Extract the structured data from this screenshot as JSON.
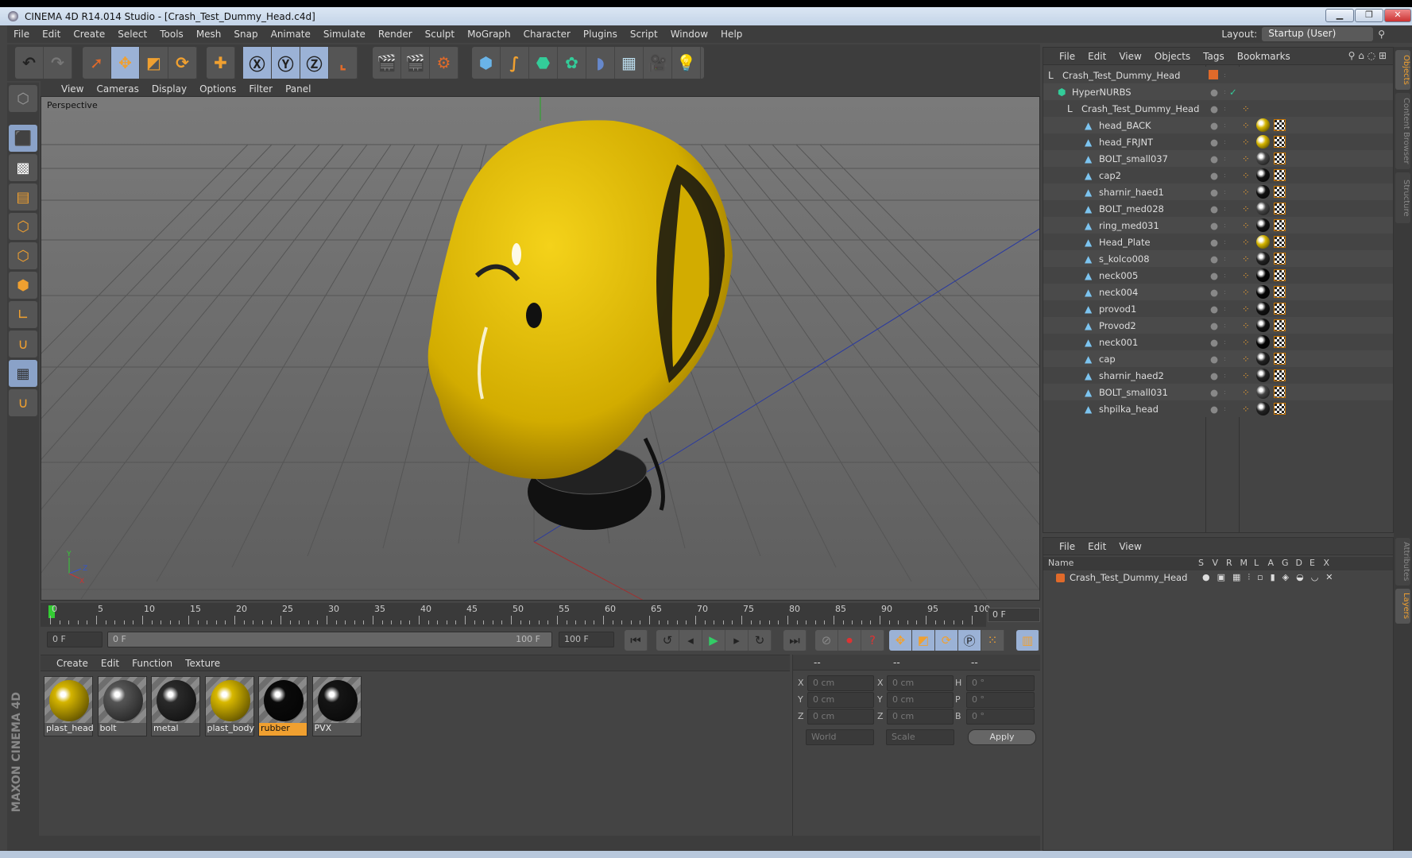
{
  "window": {
    "title": "CINEMA 4D R14.014 Studio - [Crash_Test_Dummy_Head.c4d]"
  },
  "menu": [
    "File",
    "Edit",
    "Create",
    "Select",
    "Tools",
    "Mesh",
    "Snap",
    "Animate",
    "Simulate",
    "Render",
    "Sculpt",
    "MoGraph",
    "Character",
    "Plugins",
    "Script",
    "Window",
    "Help"
  ],
  "layout": {
    "label": "Layout:",
    "value": "Startup (User)"
  },
  "viewport": {
    "menu": [
      "View",
      "Cameras",
      "Display",
      "Options",
      "Filter",
      "Panel"
    ],
    "camera": "Perspective"
  },
  "timeline": {
    "ticks": [
      "0",
      "5",
      "10",
      "15",
      "20",
      "25",
      "30",
      "35",
      "40",
      "45",
      "50",
      "55",
      "60",
      "65",
      "70",
      "75",
      "80",
      "85",
      "90",
      "95",
      "100"
    ],
    "current": "0 F",
    "start": "0 F",
    "range_start": "0 F",
    "range_end": "100 F",
    "end": "100 F"
  },
  "materials": {
    "menu": [
      "Create",
      "Edit",
      "Function",
      "Texture"
    ],
    "items": [
      {
        "name": "plast_head",
        "color": "#d4b400"
      },
      {
        "name": "bolt",
        "color": "#555555"
      },
      {
        "name": "metal",
        "color": "#2a2a2a"
      },
      {
        "name": "plast_body",
        "color": "#d8b800"
      },
      {
        "name": "rubber",
        "color": "#0a0a0a",
        "selected": true
      },
      {
        "name": "PVX",
        "color": "#151515"
      }
    ]
  },
  "coords": {
    "headers": [
      "--",
      "--",
      "--"
    ],
    "rows": [
      {
        "a": "X",
        "av": "0 cm",
        "b": "X",
        "bv": "0 cm",
        "c": "H",
        "cv": "0 °"
      },
      {
        "a": "Y",
        "av": "0 cm",
        "b": "Y",
        "bv": "0 cm",
        "c": "P",
        "cv": "0 °"
      },
      {
        "a": "Z",
        "av": "0 cm",
        "b": "Z",
        "bv": "0 cm",
        "c": "B",
        "cv": "0 °"
      }
    ],
    "space": "World",
    "mode": "Scale",
    "apply": "Apply"
  },
  "objects": {
    "menu": [
      "File",
      "Edit",
      "View",
      "Objects",
      "Tags",
      "Bookmarks"
    ],
    "root": "Crash_Test_Dummy_Head",
    "nurbs": "HyperNURBS",
    "group": "Crash_Test_Dummy_Head",
    "items": [
      {
        "name": "head_BACK",
        "mat": "#d4b400"
      },
      {
        "name": "head_FRJNT",
        "mat": "#d4b400"
      },
      {
        "name": "BOLT_small037",
        "mat": "#444"
      },
      {
        "name": "cap2",
        "mat": "#111"
      },
      {
        "name": "sharnir_haed1",
        "mat": "#111"
      },
      {
        "name": "BOLT_med028",
        "mat": "#444"
      },
      {
        "name": "ring_med031",
        "mat": "#111"
      },
      {
        "name": "Head_Plate",
        "mat": "#d4b400"
      },
      {
        "name": "s_kolco008",
        "mat": "#222"
      },
      {
        "name": "neck005",
        "mat": "#050505"
      },
      {
        "name": "neck004",
        "mat": "#050505"
      },
      {
        "name": "provod1",
        "mat": "#111"
      },
      {
        "name": "Provod2",
        "mat": "#111"
      },
      {
        "name": "neck001",
        "mat": "#050505"
      },
      {
        "name": "cap",
        "mat": "#222"
      },
      {
        "name": "sharnir_haed2",
        "mat": "#222"
      },
      {
        "name": "BOLT_small031",
        "mat": "#444"
      },
      {
        "name": "shpilka_head",
        "mat": "#222"
      }
    ]
  },
  "layers": {
    "menu": [
      "File",
      "Edit",
      "View"
    ],
    "name_header": "Name",
    "cols": [
      "S",
      "V",
      "R",
      "M",
      "L",
      "A",
      "G",
      "D",
      "E",
      "X"
    ],
    "row": "Crash_Test_Dummy_Head"
  },
  "sidetabs": [
    "Objects",
    "Content Browser",
    "Structure",
    "Attributes",
    "Layers"
  ],
  "brand": "MAXON CINEMA 4D",
  "colors": {
    "accent": "#f0a030",
    "selection": "#9bb2d6",
    "object_orange": "#e06a2a"
  }
}
